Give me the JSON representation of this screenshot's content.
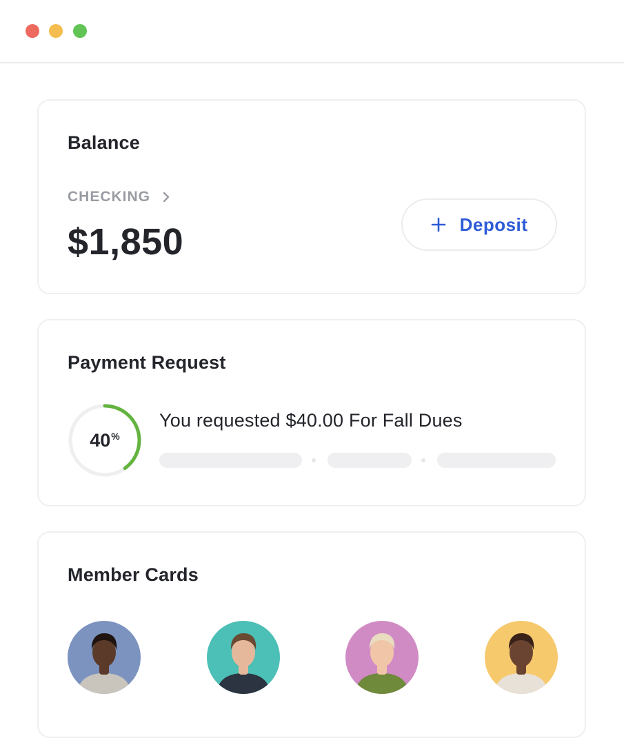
{
  "window": {
    "controls": {
      "close_color": "#ee6a5f",
      "minimize_color": "#f5bd4f",
      "zoom_color": "#61c454"
    }
  },
  "balance": {
    "title": "Balance",
    "account_label": "CHECKING",
    "amount": "$1,850",
    "deposit_label": "Deposit",
    "accent_color": "#2d5bd7"
  },
  "payment_request": {
    "title": "Payment Request",
    "progress_value": "40",
    "progress_symbol": "%",
    "progress_fraction": 0.4,
    "progress_color": "#63b43f",
    "message": "You requested $40.00 For Fall Dues"
  },
  "members": {
    "title": "Member Cards",
    "avatars": [
      {
        "background": "#7c93bf",
        "skin": "#5b3a29",
        "hair": "#1f1410",
        "shirt": "#c9c5bd"
      },
      {
        "background": "#4cbfb6",
        "skin": "#e6b89b",
        "hair": "#6b4a32",
        "shirt": "#2b3440"
      },
      {
        "background": "#d08bc4",
        "skin": "#f1c6a8",
        "hair": "#e9dcc0",
        "shirt": "#6e8a3a"
      },
      {
        "background": "#f7c96d",
        "skin": "#6a4331",
        "hair": "#3a2218",
        "shirt": "#e8e1d8"
      }
    ]
  }
}
